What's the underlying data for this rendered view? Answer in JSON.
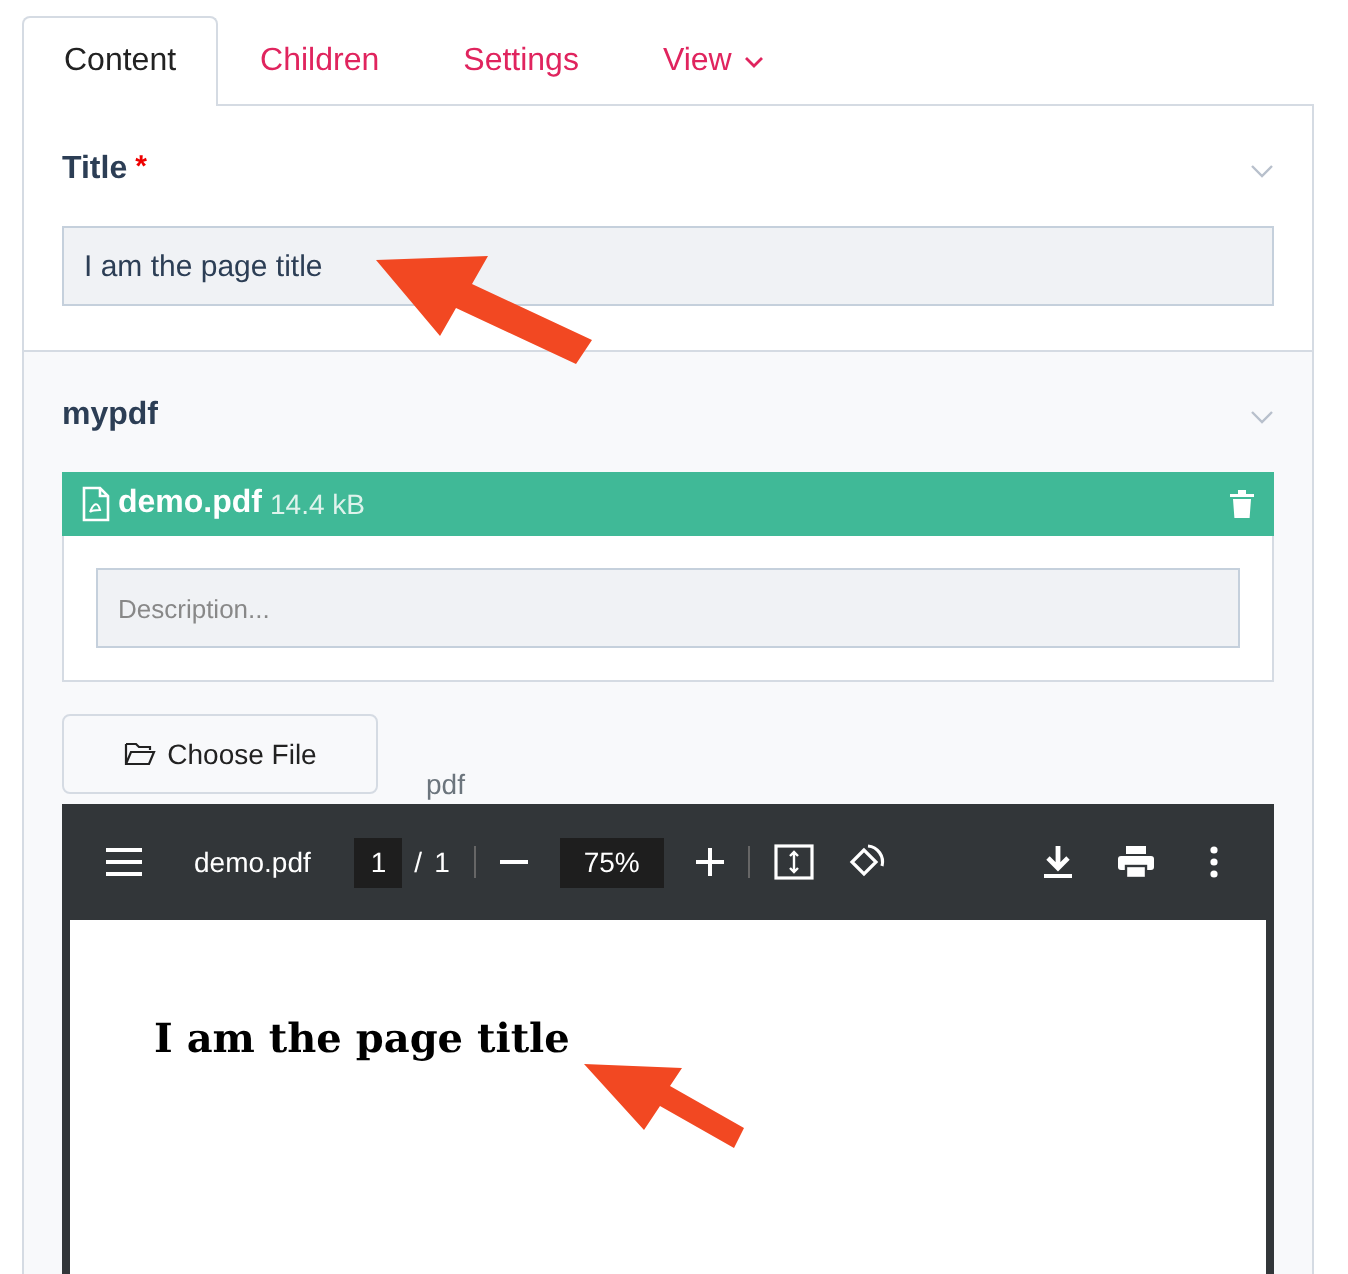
{
  "tabs": [
    {
      "label": "Content",
      "selected": true,
      "dropdown": false
    },
    {
      "label": "Children",
      "selected": false,
      "dropdown": false
    },
    {
      "label": "Settings",
      "selected": false,
      "dropdown": false
    },
    {
      "label": "View",
      "selected": false,
      "dropdown": true
    }
  ],
  "title_field": {
    "label": "Title",
    "required": true,
    "required_mark": "*",
    "value": "I am the page title"
  },
  "file_field": {
    "label": "mypdf",
    "file_name": "demo.pdf",
    "file_size": "14.4 kB",
    "description_placeholder": "Description...",
    "choose_button": "Choose File",
    "type_label": "pdf"
  },
  "pdf_viewer": {
    "file_name": "demo.pdf",
    "page": "1",
    "page_separator": "/",
    "page_count": "1",
    "zoom": "75%",
    "page_text": "I am the page title"
  }
}
